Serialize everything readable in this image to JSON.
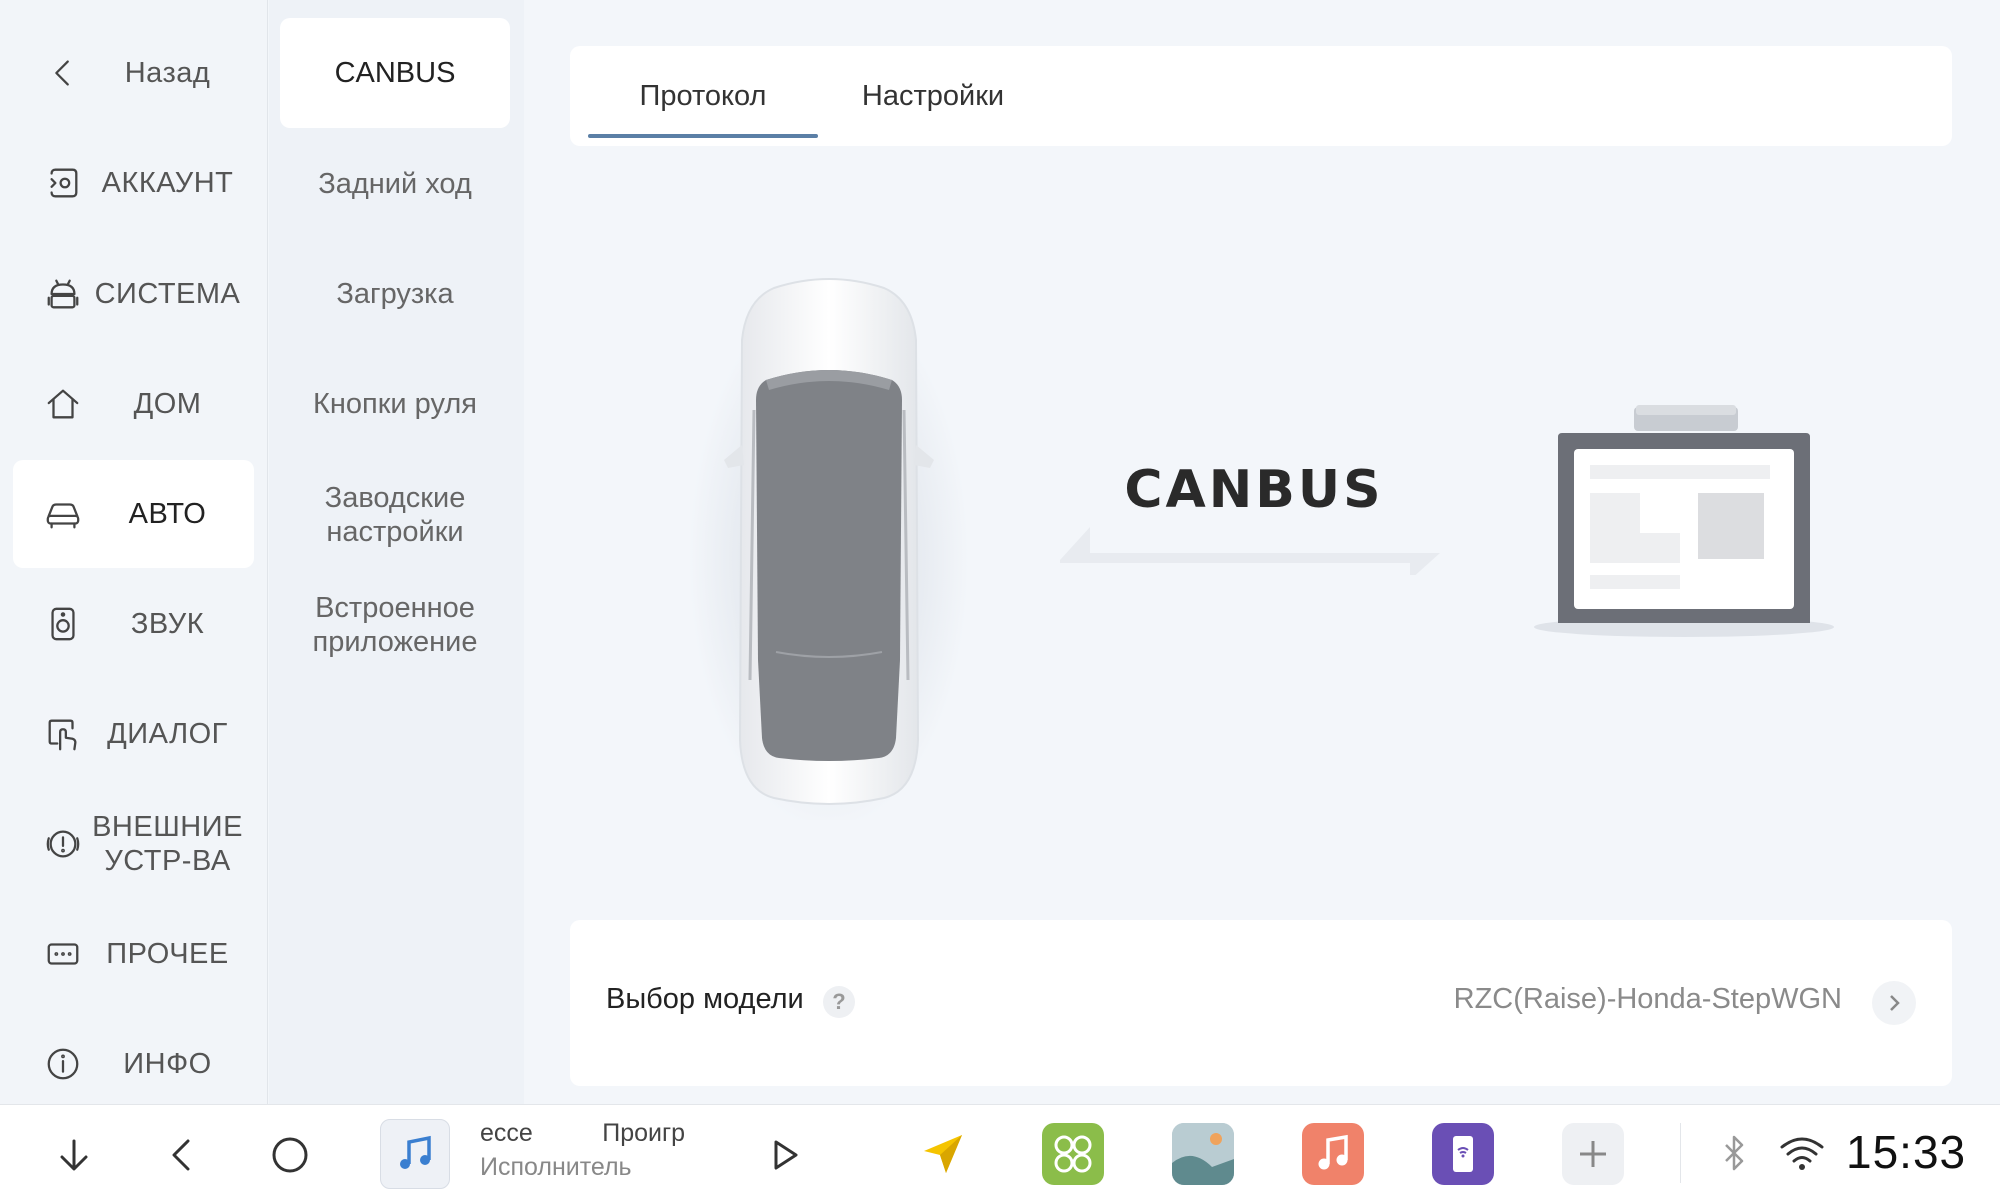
{
  "nav": {
    "items": [
      {
        "label": "Назад",
        "icon": "back-icon"
      },
      {
        "label": "АККАУНТ",
        "icon": "account-icon"
      },
      {
        "label": "СИСТЕМА",
        "icon": "android-icon"
      },
      {
        "label": "ДОМ",
        "icon": "home-icon"
      },
      {
        "label": "АВТО",
        "icon": "car-icon",
        "active": true
      },
      {
        "label": "ЗВУК",
        "icon": "speaker-icon"
      },
      {
        "label": "ДИАЛОГ",
        "icon": "touch-icon"
      },
      {
        "label": "ВНЕШНИЕ УСТР-ВА",
        "icon": "alert-icon"
      },
      {
        "label": "ПРОЧЕЕ",
        "icon": "more-icon"
      },
      {
        "label": "ИНФО",
        "icon": "info-icon"
      }
    ]
  },
  "subnav": {
    "items": [
      {
        "label": "CANBUS",
        "active": true
      },
      {
        "label": "Задний ход"
      },
      {
        "label": "Загрузка"
      },
      {
        "label": "Кнопки руля"
      },
      {
        "label": "Заводские настройки"
      },
      {
        "label": "Встроенное приложение"
      }
    ]
  },
  "tabs": [
    {
      "label": "Протокол",
      "active": true
    },
    {
      "label": "Настройки"
    }
  ],
  "illustration": {
    "bus_label": "CANBUS"
  },
  "model": {
    "label": "Выбор модели",
    "help": "?",
    "value": "RZC(Raise)-Honda-StepWGN"
  },
  "taskbar": {
    "media_title": "ecce          Проигр",
    "media_artist": "Исполнитель",
    "clock": "15:33"
  },
  "colors": {
    "accent": "#5b7fa6",
    "background": "#f3f6fa",
    "card": "#ffffff",
    "app_green": "#8bbd4a",
    "app_music": "#f0826a",
    "app_purple": "#6a4fb5",
    "app_nav": "#f5c400"
  }
}
